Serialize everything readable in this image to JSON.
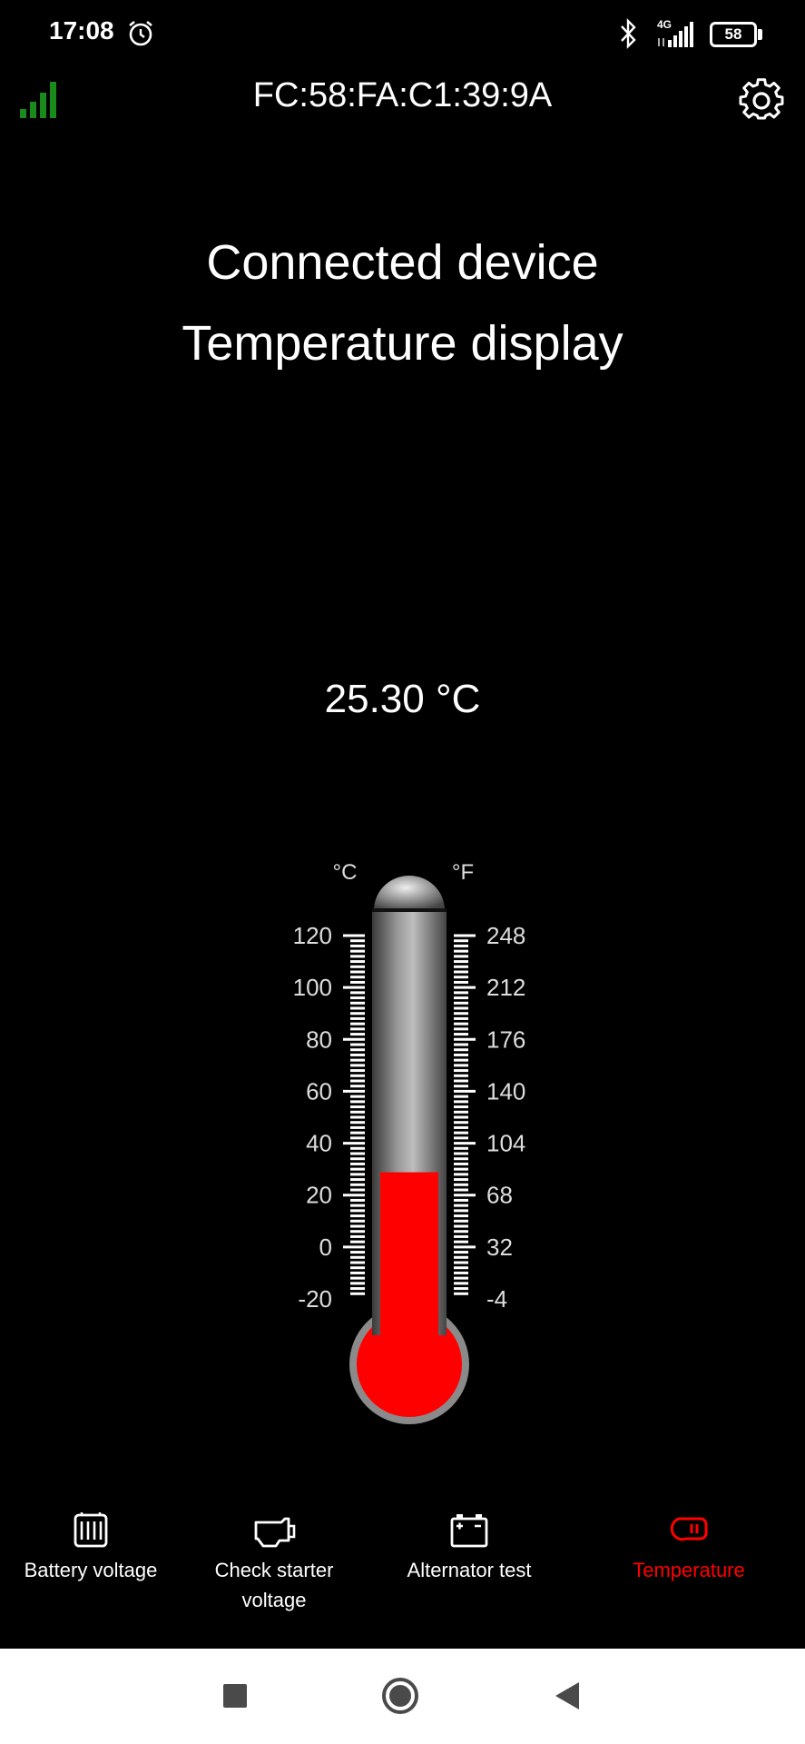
{
  "status_bar": {
    "time": "17:08",
    "network_type": "4G",
    "battery_level": "58",
    "icons": [
      "alarm-icon",
      "bluetooth-icon",
      "cell-signal-icon",
      "battery-icon"
    ]
  },
  "app_bar": {
    "device_id": "FC:58:FA:C1:39:9A",
    "signal_color": "#1a8a1a",
    "icons": [
      "signal-strength-icon",
      "gear-icon"
    ]
  },
  "main": {
    "title_line1": "Connected device",
    "title_line2": "Temperature display",
    "temperature": "25.30 °C"
  },
  "thermometer": {
    "celsius_unit": "°C",
    "fahrenheit_unit": "°F",
    "celsius_ticks": [
      "120",
      "100",
      "80",
      "60",
      "40",
      "20",
      "0",
      "-20"
    ],
    "fahrenheit_ticks": [
      "248",
      "212",
      "176",
      "140",
      "104",
      "68",
      "32",
      "-4"
    ],
    "celsius_value": 25.3,
    "scale_min": -20,
    "scale_max": 120,
    "mercury_color": "#ff0000"
  },
  "bottom_nav": {
    "items": [
      {
        "label": "Battery voltage",
        "icon": "battery-icon"
      },
      {
        "label": "Check starter voltage",
        "icon": "engine-icon"
      },
      {
        "label": "Alternator test",
        "icon": "car-battery-icon"
      },
      {
        "label": "Temperature",
        "icon": "thermometer-icon"
      }
    ],
    "active_index": 3,
    "active_color": "#ff0000"
  },
  "system_nav": {
    "icons": [
      "recents-icon",
      "home-icon",
      "back-icon"
    ]
  }
}
